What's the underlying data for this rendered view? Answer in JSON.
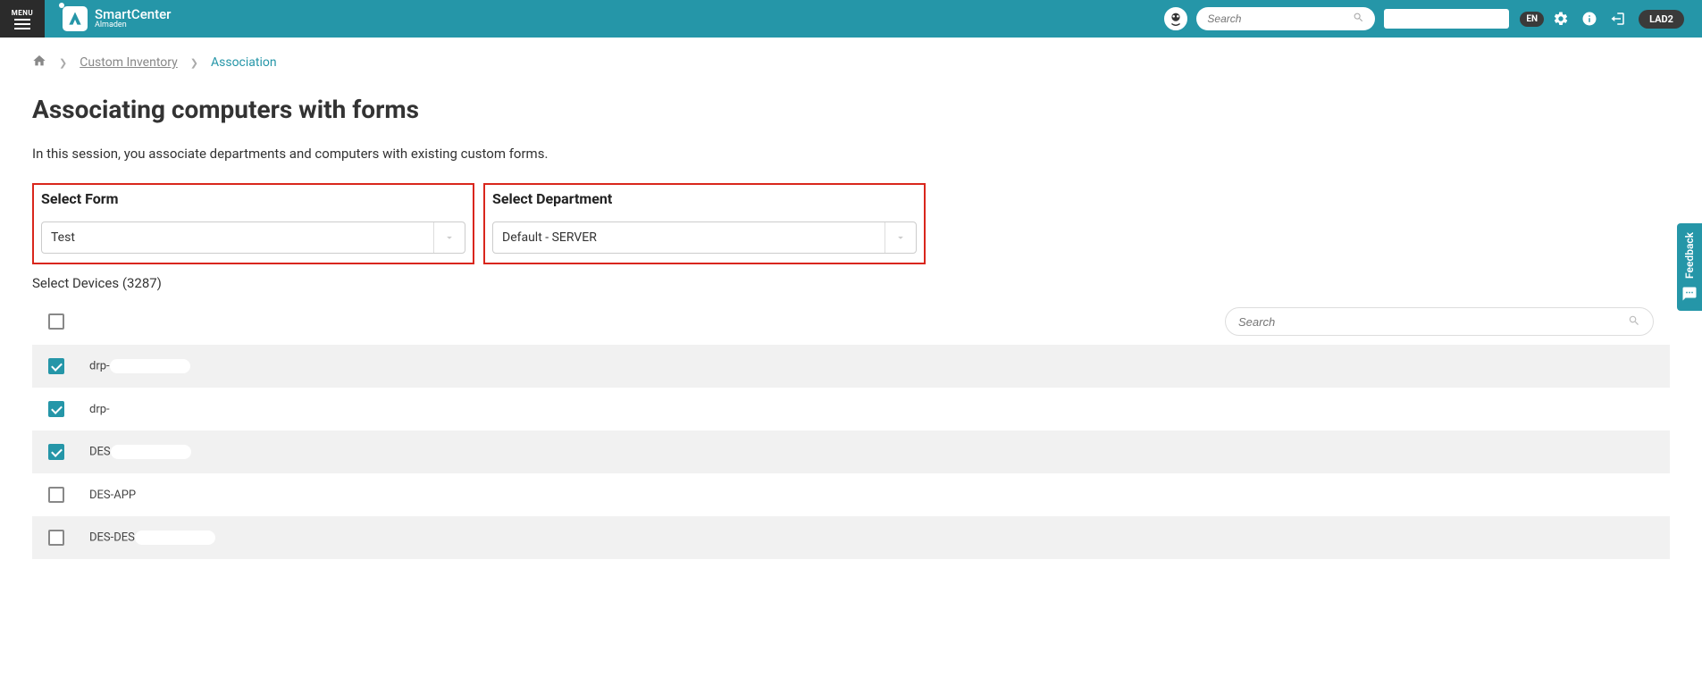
{
  "header": {
    "menu_label": "MENU",
    "brand_top": "SmartCenter",
    "brand_bottom": "Almaden",
    "search_placeholder": "Search",
    "lang": "EN",
    "env": "LAD2"
  },
  "breadcrumb": {
    "link1": "Custom Inventory",
    "current": "Association"
  },
  "page": {
    "title": "Associating computers with forms",
    "description": "In this session, you associate departments and computers with existing custom forms."
  },
  "form_select": {
    "label": "Select Form",
    "value": "Test"
  },
  "dept_select": {
    "label": "Select Department",
    "value": "Default - SERVER"
  },
  "devices": {
    "label": "Select Devices (3287)",
    "search_placeholder": "Search",
    "rows": [
      {
        "checked": true,
        "text_prefix": "drp-",
        "masked": true
      },
      {
        "checked": true,
        "text_prefix": "drp-",
        "masked": false
      },
      {
        "checked": true,
        "text_prefix": "DES",
        "masked": true
      },
      {
        "checked": false,
        "text_prefix": "DES-APP",
        "masked": false
      },
      {
        "checked": false,
        "text_prefix": "DES-DES",
        "masked": true
      }
    ]
  },
  "feedback": {
    "label": "Feedback"
  }
}
